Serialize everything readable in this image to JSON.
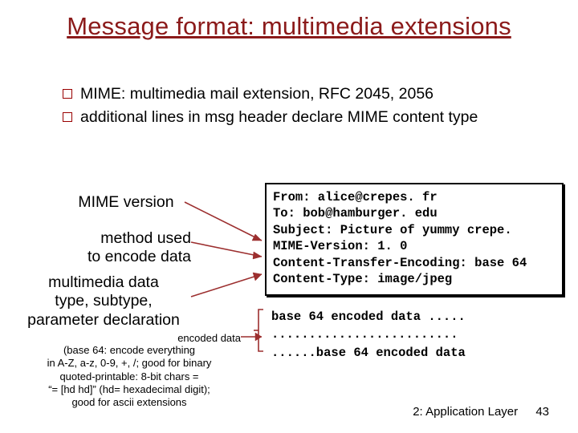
{
  "title": "Message format: multimedia extensions",
  "bullets": {
    "b1": "MIME: multimedia mail extension, RFC 2045, 2056",
    "b2": "additional lines in msg header declare MIME content type"
  },
  "labels": {
    "mime_version": "MIME version",
    "method_l1": "method used",
    "method_l2": "to encode data",
    "mtype_l1": "multimedia data",
    "mtype_l2": "type, subtype,",
    "mtype_l3": "parameter declaration",
    "encoded_data": "encoded data",
    "b64_l1": "(base 64: encode everything",
    "b64_l2": "in A-Z, a-z, 0-9, +, /; good for binary",
    "b64_l3": "quoted-printable: 8-bit chars =",
    "b64_l4": "“= [hd hd]” (hd= hexadecimal digit);",
    "b64_l5": "good for ascii extensions"
  },
  "code": {
    "l1": "From: alice@crepes. fr",
    "l2": "To: bob@hamburger. edu",
    "l3": "Subject: Picture of yummy crepe.",
    "l4": "MIME-Version: 1. 0",
    "l5": "Content-Transfer-Encoding: base 64",
    "l6": "Content-Type: image/jpeg"
  },
  "dots": {
    "d1": "base 64 encoded data .....",
    "d2": ".........................",
    "d3": "......base 64 encoded data"
  },
  "footer": {
    "chapter": "2: Application Layer",
    "page": "43"
  }
}
